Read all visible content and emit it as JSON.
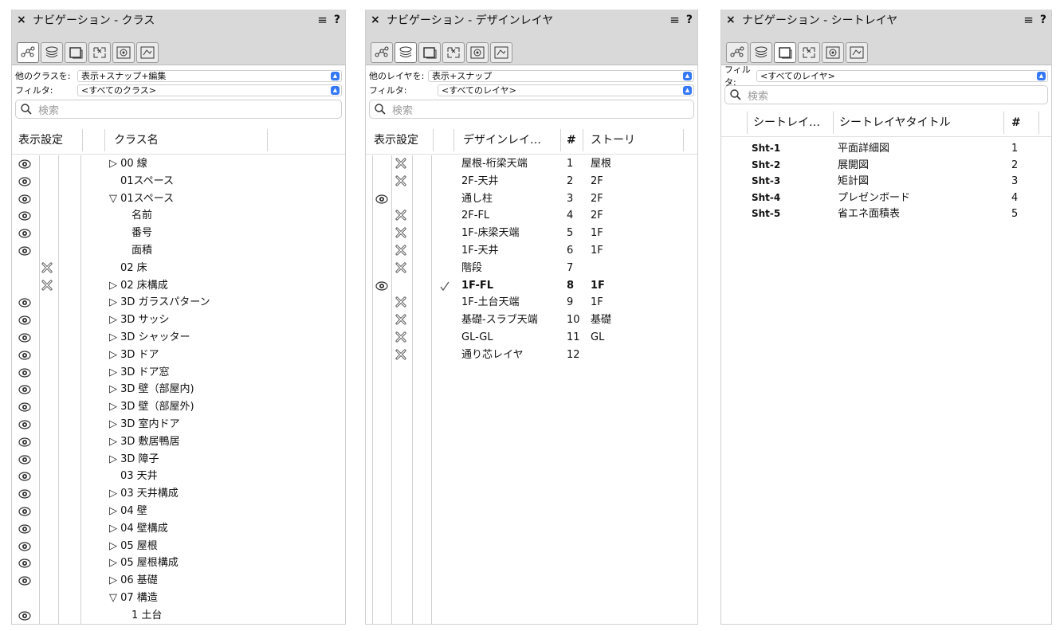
{
  "panels": {
    "classes": {
      "title": "ナビゲーション - クラス",
      "filter_label_1": "他のクラスを:",
      "filter_value_1": "表示+スナップ+編集",
      "filter_label_2": "フィルタ:",
      "filter_value_2": "<すべてのクラス>",
      "search_placeholder": "検索",
      "col_visibility": "表示設定",
      "col_name": "クラス名",
      "items": [
        {
          "vis": "eye",
          "label": "▷ 00 線",
          "indent": 1
        },
        {
          "vis": "eye",
          "label": "01スペース",
          "indent": 2
        },
        {
          "vis": "eye",
          "label": "▽ 01スペース",
          "indent": 1
        },
        {
          "vis": "eye",
          "label": "名前",
          "indent": 3
        },
        {
          "vis": "eye",
          "label": "番号",
          "indent": 3
        },
        {
          "vis": "eye",
          "label": "面積",
          "indent": 3
        },
        {
          "vis": "cross",
          "label": "02 床",
          "indent": 2
        },
        {
          "vis": "cross",
          "label": "▷ 02 床構成",
          "indent": 1
        },
        {
          "vis": "eye",
          "label": "▷ 3D ガラスパターン",
          "indent": 1
        },
        {
          "vis": "eye",
          "label": "▷ 3D サッシ",
          "indent": 1
        },
        {
          "vis": "eye",
          "label": "▷ 3D シャッター",
          "indent": 1
        },
        {
          "vis": "eye",
          "label": "▷ 3D ドア",
          "indent": 1
        },
        {
          "vis": "eye",
          "label": "▷ 3D ドア窓",
          "indent": 1
        },
        {
          "vis": "eye",
          "label": "▷ 3D 壁（部屋内)",
          "indent": 1
        },
        {
          "vis": "eye",
          "label": "▷ 3D 壁（部屋外)",
          "indent": 1
        },
        {
          "vis": "eye",
          "label": "▷ 3D 室内ドア",
          "indent": 1
        },
        {
          "vis": "eye",
          "label": "▷ 3D 敷居鴨居",
          "indent": 1
        },
        {
          "vis": "eye",
          "label": "▷ 3D 障子",
          "indent": 1
        },
        {
          "vis": "eye",
          "label": "03 天井",
          "indent": 2
        },
        {
          "vis": "eye",
          "label": "▷ 03 天井構成",
          "indent": 1
        },
        {
          "vis": "eye",
          "label": "▷ 04 壁",
          "indent": 1
        },
        {
          "vis": "eye",
          "label": "▷ 04 壁構成",
          "indent": 1
        },
        {
          "vis": "eye",
          "label": "▷ 05 屋根",
          "indent": 1
        },
        {
          "vis": "eye",
          "label": "▷ 05 屋根構成",
          "indent": 1
        },
        {
          "vis": "eye",
          "label": "▷ 06 基礎",
          "indent": 1
        },
        {
          "vis": "none",
          "label": "▽ 07 構造",
          "indent": 1
        },
        {
          "vis": "eye",
          "label": "1 土台",
          "indent": 3
        }
      ]
    },
    "design_layers": {
      "title": "ナビゲーション - デザインレイヤ",
      "filter_label_1": "他のレイヤを:",
      "filter_value_1": "表示+スナップ",
      "filter_label_2": "フィルタ:",
      "filter_value_2": "<すべてのレイヤ>",
      "search_placeholder": "検索",
      "col_visibility": "表示設定",
      "col_name": "デザインレイ…",
      "col_num": "#",
      "col_story": "ストーリ",
      "items": [
        {
          "vis": "cross",
          "name": "屋根-桁梁天端",
          "num": "1",
          "story": "屋根",
          "bold": false,
          "check": false
        },
        {
          "vis": "cross",
          "name": "2F-天井",
          "num": "2",
          "story": "2F",
          "bold": false,
          "check": false
        },
        {
          "vis": "eye",
          "name": "通し柱",
          "num": "3",
          "story": "2F",
          "bold": false,
          "check": false
        },
        {
          "vis": "cross",
          "name": "2F-FL",
          "num": "4",
          "story": "2F",
          "bold": false,
          "check": false
        },
        {
          "vis": "cross",
          "name": "1F-床梁天端",
          "num": "5",
          "story": "1F",
          "bold": false,
          "check": false
        },
        {
          "vis": "cross",
          "name": "1F-天井",
          "num": "6",
          "story": "1F",
          "bold": false,
          "check": false
        },
        {
          "vis": "cross",
          "name": "階段",
          "num": "7",
          "story": "",
          "bold": false,
          "check": false
        },
        {
          "vis": "eye",
          "name": "1F-FL",
          "num": "8",
          "story": "1F",
          "bold": true,
          "check": true
        },
        {
          "vis": "cross",
          "name": "1F-土台天端",
          "num": "9",
          "story": "1F",
          "bold": false,
          "check": false
        },
        {
          "vis": "cross",
          "name": "基礎-スラブ天端",
          "num": "10",
          "story": "基礎",
          "bold": false,
          "check": false
        },
        {
          "vis": "cross",
          "name": "GL-GL",
          "num": "11",
          "story": "GL",
          "bold": false,
          "check": false
        },
        {
          "vis": "cross",
          "name": "通り芯レイヤ",
          "num": "12",
          "story": "",
          "bold": false,
          "check": false
        }
      ]
    },
    "sheet_layers": {
      "title": "ナビゲーション - シートレイヤ",
      "filter_label": "フィルタ:",
      "filter_value": "<すべてのレイヤ>",
      "search_placeholder": "検索",
      "col_number": "シートレイ…",
      "col_title": "シートレイヤタイトル",
      "col_num": "#",
      "items": [
        {
          "number": "Sht-1",
          "title": "平面詳細図",
          "num": "1"
        },
        {
          "number": "Sht-2",
          "title": "展開図",
          "num": "2"
        },
        {
          "number": "Sht-3",
          "title": "矩計図",
          "num": "3"
        },
        {
          "number": "Sht-4",
          "title": "プレゼンボード",
          "num": "4"
        },
        {
          "number": "Sht-5",
          "title": "省エネ面積表",
          "num": "5"
        }
      ]
    }
  },
  "common": {
    "menu_glyph": "≡",
    "help_glyph": "?",
    "close_glyph": "×"
  }
}
